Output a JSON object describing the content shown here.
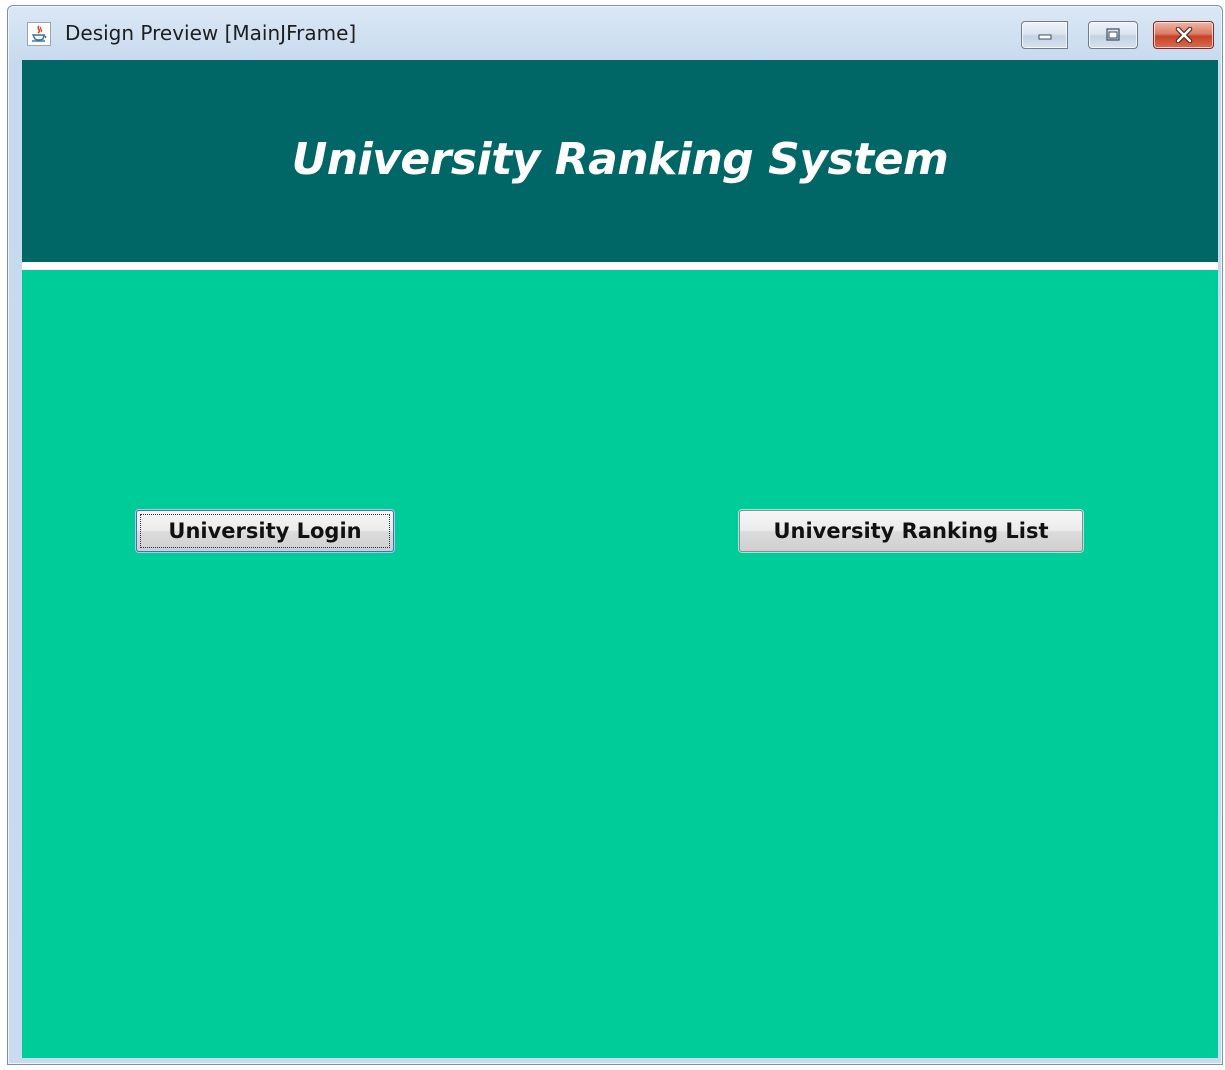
{
  "window": {
    "title": "Design Preview [MainJFrame]",
    "icon": "java-cup-icon",
    "controls": [
      "minimize-icon",
      "maximize-icon",
      "close-icon"
    ]
  },
  "header": {
    "title": "University Ranking System",
    "background_color": "#006666",
    "text_color": "#ffffff"
  },
  "main": {
    "background_color": "#00cc99",
    "buttons": [
      {
        "label": "University Login",
        "focused": true
      },
      {
        "label": "University Ranking List",
        "focused": false
      }
    ]
  }
}
